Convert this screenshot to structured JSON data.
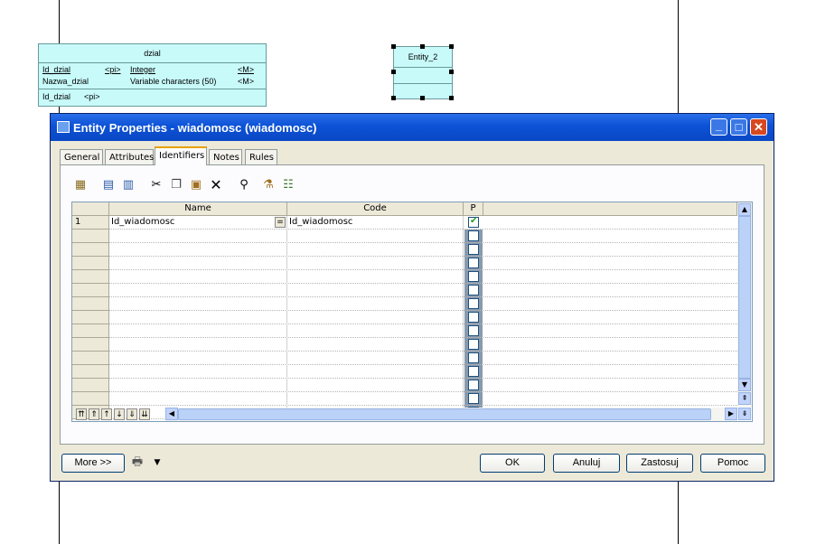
{
  "diagram": {
    "entity_dzial": {
      "title": "dzial",
      "attributes": [
        {
          "name": "Id_dzial",
          "key": "<pi>",
          "type": "Integer",
          "mandatory": "<M>"
        },
        {
          "name": "Nazwa_dzial",
          "key": "",
          "type": "Variable characters (50)",
          "mandatory": "<M>"
        }
      ],
      "identifier": "Id_dzial",
      "identifier_key": "<pi>"
    },
    "entity_2": {
      "title": "Entity_2"
    }
  },
  "dialog": {
    "title": "Entity Properties - wiadomosc (wiadomosc)",
    "window_buttons": {
      "minimize": "_",
      "maximize": "□",
      "close": "✕"
    },
    "tabs": [
      {
        "label": "General",
        "active": false
      },
      {
        "label": "Attributes",
        "active": false
      },
      {
        "label": "Identifiers",
        "active": true
      },
      {
        "label": "Notes",
        "active": false
      },
      {
        "label": "Rules",
        "active": false
      }
    ],
    "toolbar": [
      {
        "icon": "properties-icon"
      },
      {
        "icon": "insert-row-icon"
      },
      {
        "icon": "add-row-icon"
      },
      {
        "icon": "cut-icon"
      },
      {
        "icon": "copy-icon"
      },
      {
        "icon": "paste-icon"
      },
      {
        "icon": "delete-icon"
      },
      {
        "icon": "find-icon"
      },
      {
        "icon": "filter-icon"
      },
      {
        "icon": "customize-columns-icon"
      }
    ],
    "grid": {
      "columns": [
        "Name",
        "Code",
        "P"
      ],
      "rows": [
        {
          "num": "1",
          "name": "Id_wiadomosc",
          "code": "Id_wiadomosc",
          "primary": true
        }
      ],
      "empty_rows": 14,
      "ellipsis": "="
    },
    "buttons": {
      "more": "More >>",
      "ok": "OK",
      "cancel": "Anuluj",
      "apply": "Zastosuj",
      "help": "Pomoc"
    }
  },
  "colors": {
    "entity_fill": "#c8fafa",
    "titlebar": "#0c52d6",
    "dialog_bg": "#ece9d8"
  }
}
